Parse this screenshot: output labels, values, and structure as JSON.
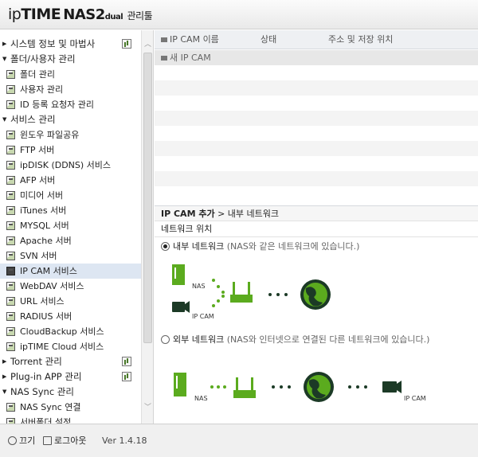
{
  "header": {
    "logo_ip": "ip",
    "logo_time": "TIME",
    "logo_nas": "NAS2",
    "logo_dual": "dual",
    "logo_tool": " 관리툴"
  },
  "sidebar": {
    "items": [
      {
        "label": "시스템 정보 및 마법사",
        "type": "cat",
        "expanded": false,
        "icon": "chart-icon"
      },
      {
        "label": "폴더/사용자 관리",
        "type": "cat",
        "expanded": true
      },
      {
        "label": "폴더 관리",
        "type": "sub",
        "icon": "folder-icon"
      },
      {
        "label": "사용자 관리",
        "type": "sub",
        "icon": "user-icon"
      },
      {
        "label": "ID 등록 요청자 관리",
        "type": "sub",
        "icon": "user-request-icon"
      },
      {
        "label": "서비스 관리",
        "type": "cat",
        "expanded": true
      },
      {
        "label": "윈도우 파일공유",
        "type": "sub",
        "icon": "service-icon"
      },
      {
        "label": "FTP 서버",
        "type": "sub",
        "icon": "service-icon"
      },
      {
        "label": "ipDISK (DDNS) 서비스",
        "type": "sub",
        "icon": "service-icon"
      },
      {
        "label": "AFP 서버",
        "type": "sub",
        "icon": "service-icon"
      },
      {
        "label": "미디어 서버",
        "type": "sub",
        "icon": "service-icon"
      },
      {
        "label": "iTunes 서버",
        "type": "sub",
        "icon": "service-icon"
      },
      {
        "label": "MYSQL 서버",
        "type": "sub",
        "icon": "service-icon"
      },
      {
        "label": "Apache 서버",
        "type": "sub",
        "icon": "service-icon"
      },
      {
        "label": "SVN 서버",
        "type": "sub",
        "icon": "service-icon"
      },
      {
        "label": "IP CAM 서비스",
        "type": "sub",
        "icon": "service-icon",
        "active": true
      },
      {
        "label": "WebDAV 서비스",
        "type": "sub",
        "icon": "service-icon"
      },
      {
        "label": "URL 서비스",
        "type": "sub",
        "icon": "service-icon"
      },
      {
        "label": "RADIUS 서버",
        "type": "sub",
        "icon": "service-icon"
      },
      {
        "label": "CloudBackup 서비스",
        "type": "sub",
        "icon": "service-icon"
      },
      {
        "label": "ipTIME Cloud 서비스",
        "type": "sub",
        "icon": "service-icon"
      },
      {
        "label": "Torrent 관리",
        "type": "cat",
        "expanded": false,
        "icon": "torrent-icon"
      },
      {
        "label": "Plug-in APP 관리",
        "type": "cat",
        "expanded": false,
        "icon": "plugin-icon"
      },
      {
        "label": "NAS Sync 관리",
        "type": "cat",
        "expanded": true
      },
      {
        "label": "NAS Sync 연결",
        "type": "sub",
        "icon": "sync-icon"
      },
      {
        "label": "서버폴더 설정",
        "type": "sub",
        "icon": "sync-icon"
      }
    ]
  },
  "bottombar": {
    "power_label": "끄기",
    "logout_label": "로그아웃",
    "version": "Ver 1.4.18"
  },
  "main": {
    "table": {
      "col_name": "IP CAM 이름",
      "col_status": "상태",
      "col_address": "주소 및 저장 위치",
      "new_cam": "새 IP CAM"
    },
    "section_title": "IP CAM 추가",
    "section_sub": " > 내부 네트워크",
    "location_label": "네트워크 위치",
    "internal_label": "내부 네트워크",
    "internal_hint": "(NAS와 같은 네트워크에 있습니다.)",
    "external_label": "외부 네트워크",
    "external_hint": "(NAS와 인터넷으로 연결된 다른 네트워크에 있습니다.)",
    "diagram_nas": "NAS",
    "diagram_ipcam": "IP CAM",
    "selected": "internal"
  },
  "colors": {
    "accent_green": "#5bab1e",
    "dark_green": "#1c3a26",
    "active_row": "#dde6f2"
  }
}
